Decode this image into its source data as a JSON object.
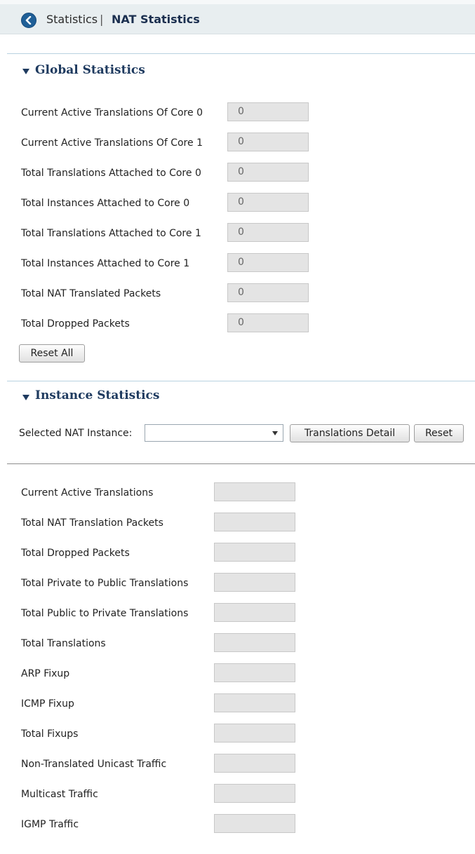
{
  "header": {
    "breadcrumb_parent": "Statistics",
    "breadcrumb_separator": "|",
    "breadcrumb_current": "NAT Statistics"
  },
  "global": {
    "title": "Global Statistics",
    "rows": [
      {
        "label": "Current Active Translations Of Core 0",
        "value": "0"
      },
      {
        "label": "Current Active Translations Of Core 1",
        "value": "0"
      },
      {
        "label": "Total Translations Attached to Core 0",
        "value": "0"
      },
      {
        "label": "Total Instances Attached to Core 0",
        "value": "0"
      },
      {
        "label": "Total Translations Attached to Core 1",
        "value": "0"
      },
      {
        "label": "Total Instances Attached to Core 1",
        "value": "0"
      },
      {
        "label": "Total NAT Translated Packets",
        "value": "0"
      },
      {
        "label": "Total Dropped Packets",
        "value": "0"
      }
    ],
    "reset_all_label": "Reset All"
  },
  "instance": {
    "title": "Instance Statistics",
    "selector_label": "Selected NAT Instance:",
    "selected_value": "",
    "translations_detail_label": "Translations Detail",
    "reset_label": "Reset",
    "rows": [
      {
        "label": "Current Active Translations",
        "value": ""
      },
      {
        "label": "Total NAT Translation Packets",
        "value": ""
      },
      {
        "label": "Total Dropped Packets",
        "value": ""
      },
      {
        "label": "Total Private to Public Translations",
        "value": ""
      },
      {
        "label": "Total Public to Private Translations",
        "value": ""
      },
      {
        "label": "Total Translations",
        "value": ""
      },
      {
        "label": "ARP Fixup",
        "value": ""
      },
      {
        "label": "ICMP Fixup",
        "value": ""
      },
      {
        "label": "Total Fixups",
        "value": ""
      },
      {
        "label": "Non-Translated Unicast Traffic",
        "value": ""
      },
      {
        "label": "Multicast Traffic",
        "value": ""
      },
      {
        "label": "IGMP Traffic",
        "value": ""
      }
    ]
  },
  "colors": {
    "header_bg": "#e8eef0",
    "back_button": "#1f5f97",
    "section_title": "#1e3a5f",
    "field_bg": "#e4e4e4",
    "divider": "#b9d2e0"
  }
}
